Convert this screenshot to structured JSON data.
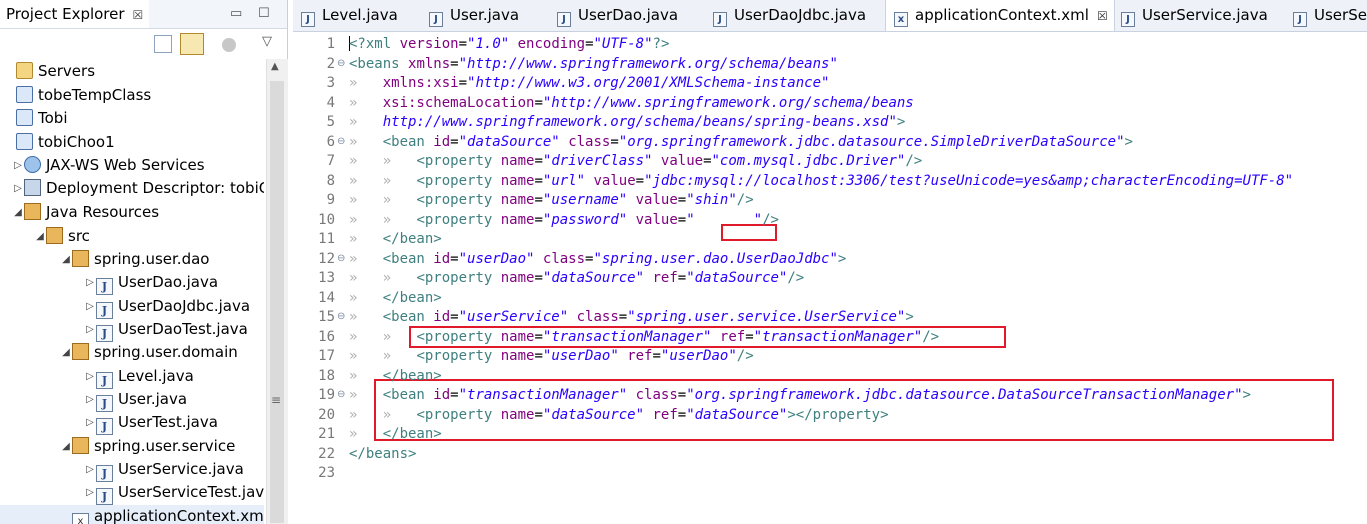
{
  "explorer": {
    "title": "Project Explorer",
    "close_glyph": "☒",
    "minimize_glyph": "▭",
    "maximize_glyph": "☐",
    "menu_glyph": "▽",
    "rows": [
      {
        "label": "Servers",
        "icon": "folder-icon",
        "twisty": "",
        "indent": 0
      },
      {
        "label": "tobeTempClass",
        "icon": "project-icon",
        "twisty": "",
        "indent": 0
      },
      {
        "label": "Tobi",
        "icon": "project-icon",
        "twisty": "",
        "indent": 0
      },
      {
        "label": "tobiChoo1",
        "icon": "project-icon",
        "twisty": "",
        "indent": 0
      },
      {
        "label": "JAX-WS Web Services",
        "icon": "web-services-icon",
        "twisty": "▷",
        "indent": 1
      },
      {
        "label": "Deployment Descriptor: tobiC",
        "icon": "deployment-descriptor-icon",
        "twisty": "▷",
        "indent": 1
      },
      {
        "label": "Java Resources",
        "icon": "java-resources-icon",
        "twisty": "◢",
        "indent": 1
      },
      {
        "label": "src",
        "icon": "source-folder-icon",
        "twisty": "◢",
        "indent": 2
      },
      {
        "label": "spring.user.dao",
        "icon": "package-icon",
        "twisty": "◢",
        "indent": 3
      },
      {
        "label": "UserDao.java",
        "icon": "java-file-icon",
        "twisty": "▷",
        "indent": 4
      },
      {
        "label": "UserDaoJdbc.java",
        "icon": "java-file-icon",
        "twisty": "▷",
        "indent": 4
      },
      {
        "label": "UserDaoTest.java",
        "icon": "java-file-icon",
        "twisty": "▷",
        "indent": 4
      },
      {
        "label": "spring.user.domain",
        "icon": "package-icon",
        "twisty": "◢",
        "indent": 3
      },
      {
        "label": "Level.java",
        "icon": "java-file-icon",
        "twisty": "▷",
        "indent": 4
      },
      {
        "label": "User.java",
        "icon": "java-file-icon",
        "twisty": "▷",
        "indent": 4
      },
      {
        "label": "UserTest.java",
        "icon": "java-file-icon",
        "twisty": "▷",
        "indent": 4
      },
      {
        "label": "spring.user.service",
        "icon": "package-icon",
        "twisty": "◢",
        "indent": 3
      },
      {
        "label": "UserService.java",
        "icon": "java-file-icon",
        "twisty": "▷",
        "indent": 4
      },
      {
        "label": "UserServiceTest.java",
        "icon": "java-file-icon",
        "twisty": "▷",
        "indent": 4
      },
      {
        "label": "applicationContext.xml",
        "icon": "xml-file-icon",
        "twisty": "",
        "indent": 3
      }
    ]
  },
  "editor": {
    "tabs": [
      {
        "label": "Level.java",
        "icon": "java-file-icon",
        "active": false
      },
      {
        "label": "User.java",
        "icon": "java-file-icon",
        "active": false
      },
      {
        "label": "UserDao.java",
        "icon": "java-file-icon",
        "active": false
      },
      {
        "label": "UserDaoJdbc.java",
        "icon": "java-file-icon",
        "active": false
      },
      {
        "label": "applicationContext.xml",
        "icon": "xml-file-icon",
        "active": true
      },
      {
        "label": "UserService.java",
        "icon": "java-file-icon",
        "active": false
      },
      {
        "label": "UserSe",
        "icon": "java-file-icon",
        "active": false
      }
    ],
    "active_tab_close": "☒",
    "lines": [
      {
        "n": "1",
        "fold": "",
        "guides": "",
        "parts": [
          [
            "pi",
            "<?xml "
          ],
          [
            "an",
            "version"
          ],
          [
            "txt",
            "="
          ],
          [
            "av",
            "\"1.0\""
          ],
          [
            "txt",
            " "
          ],
          [
            "an",
            "encoding"
          ],
          [
            "txt",
            "="
          ],
          [
            "av",
            "\"UTF-8\""
          ],
          [
            "pi",
            "?>"
          ]
        ]
      },
      {
        "n": "2",
        "fold": "⊖",
        "guides": "",
        "parts": [
          [
            "tag",
            "<beans "
          ],
          [
            "an",
            "xmlns"
          ],
          [
            "txt",
            "="
          ],
          [
            "av",
            "\"http://www.springframework.org/schema/beans\""
          ]
        ]
      },
      {
        "n": "3",
        "fold": "",
        "guides": "»   ",
        "parts": [
          [
            "an",
            "xmlns:xsi"
          ],
          [
            "txt",
            "="
          ],
          [
            "av",
            "\"http://www.w3.org/2001/XMLSchema-instance\""
          ]
        ]
      },
      {
        "n": "4",
        "fold": "",
        "guides": "»   ",
        "parts": [
          [
            "an",
            "xsi:schemaLocation"
          ],
          [
            "txt",
            "="
          ],
          [
            "av",
            "\"http://www.springframework.org/schema/beans"
          ]
        ]
      },
      {
        "n": "5",
        "fold": "",
        "guides": "»   ",
        "parts": [
          [
            "av",
            "http://www.springframework.org/schema/beans/spring-beans.xsd\""
          ],
          [
            "tag",
            ">"
          ]
        ]
      },
      {
        "n": "6",
        "fold": "⊖",
        "guides": "»   ",
        "parts": [
          [
            "tag",
            "<bean "
          ],
          [
            "an",
            "id"
          ],
          [
            "txt",
            "="
          ],
          [
            "av",
            "\"dataSource\""
          ],
          [
            "txt",
            " "
          ],
          [
            "an",
            "class"
          ],
          [
            "txt",
            "="
          ],
          [
            "av",
            "\"org.springframework.jdbc.datasource.SimpleDriverDataSource\""
          ],
          [
            "tag",
            ">"
          ]
        ]
      },
      {
        "n": "7",
        "fold": "",
        "guides": "»   »   ",
        "parts": [
          [
            "tag",
            "<property "
          ],
          [
            "an",
            "name"
          ],
          [
            "txt",
            "="
          ],
          [
            "av",
            "\"driverClass\""
          ],
          [
            "txt",
            " "
          ],
          [
            "an",
            "value"
          ],
          [
            "txt",
            "="
          ],
          [
            "av",
            "\"com.mysql.jdbc.Driver\""
          ],
          [
            "tag",
            "/>"
          ]
        ]
      },
      {
        "n": "8",
        "fold": "",
        "guides": "»   »   ",
        "parts": [
          [
            "tag",
            "<property "
          ],
          [
            "an",
            "name"
          ],
          [
            "txt",
            "="
          ],
          [
            "av",
            "\"url\""
          ],
          [
            "txt",
            " "
          ],
          [
            "an",
            "value"
          ],
          [
            "txt",
            "="
          ],
          [
            "av",
            "\"jdbc:mysql://localhost:3306/test?useUnicode=yes&amp;characterEncoding=UTF-8\""
          ]
        ]
      },
      {
        "n": "9",
        "fold": "",
        "guides": "»   »   ",
        "parts": [
          [
            "tag",
            "<property "
          ],
          [
            "an",
            "name"
          ],
          [
            "txt",
            "="
          ],
          [
            "av",
            "\"username\""
          ],
          [
            "txt",
            " "
          ],
          [
            "an",
            "value"
          ],
          [
            "txt",
            "="
          ],
          [
            "av",
            "\"shin\""
          ],
          [
            "tag",
            "/>"
          ]
        ]
      },
      {
        "n": "10",
        "fold": "",
        "guides": "»   »   ",
        "parts": [
          [
            "tag",
            "<property "
          ],
          [
            "an",
            "name"
          ],
          [
            "txt",
            "="
          ],
          [
            "av",
            "\"password\""
          ],
          [
            "txt",
            " "
          ],
          [
            "an",
            "value"
          ],
          [
            "txt",
            "="
          ],
          [
            "av",
            "\"       \""
          ],
          [
            "tag",
            "/>"
          ]
        ]
      },
      {
        "n": "11",
        "fold": "",
        "guides": "»   ",
        "parts": [
          [
            "tag",
            "</bean>"
          ]
        ]
      },
      {
        "n": "12",
        "fold": "⊖",
        "guides": "»   ",
        "parts": [
          [
            "tag",
            "<bean "
          ],
          [
            "an",
            "id"
          ],
          [
            "txt",
            "="
          ],
          [
            "av",
            "\"userDao\""
          ],
          [
            "txt",
            " "
          ],
          [
            "an",
            "class"
          ],
          [
            "txt",
            "="
          ],
          [
            "av",
            "\"spring.user.dao.UserDaoJdbc\""
          ],
          [
            "tag",
            ">"
          ]
        ]
      },
      {
        "n": "13",
        "fold": "",
        "guides": "»   »   ",
        "parts": [
          [
            "tag",
            "<property "
          ],
          [
            "an",
            "name"
          ],
          [
            "txt",
            "="
          ],
          [
            "av",
            "\"dataSource\""
          ],
          [
            "txt",
            " "
          ],
          [
            "an",
            "ref"
          ],
          [
            "txt",
            "="
          ],
          [
            "av",
            "\"dataSource\""
          ],
          [
            "tag",
            "/>"
          ]
        ]
      },
      {
        "n": "14",
        "fold": "",
        "guides": "»   ",
        "parts": [
          [
            "tag",
            "</bean>"
          ]
        ]
      },
      {
        "n": "15",
        "fold": "⊖",
        "guides": "»   ",
        "parts": [
          [
            "tag",
            "<bean "
          ],
          [
            "an",
            "id"
          ],
          [
            "txt",
            "="
          ],
          [
            "av",
            "\"userService\""
          ],
          [
            "txt",
            " "
          ],
          [
            "an",
            "class"
          ],
          [
            "txt",
            "="
          ],
          [
            "av",
            "\"spring.user.service.UserService\""
          ],
          [
            "tag",
            ">"
          ]
        ]
      },
      {
        "n": "16",
        "fold": "",
        "guides": "»   »   ",
        "parts": [
          [
            "tag",
            "<property "
          ],
          [
            "an",
            "name"
          ],
          [
            "txt",
            "="
          ],
          [
            "av",
            "\"transactionManager\""
          ],
          [
            "txt",
            " "
          ],
          [
            "an",
            "ref"
          ],
          [
            "txt",
            "="
          ],
          [
            "av",
            "\"transactionManager\""
          ],
          [
            "tag",
            "/>"
          ]
        ]
      },
      {
        "n": "17",
        "fold": "",
        "guides": "»   »   ",
        "parts": [
          [
            "tag",
            "<property "
          ],
          [
            "an",
            "name"
          ],
          [
            "txt",
            "="
          ],
          [
            "av",
            "\"userDao\""
          ],
          [
            "txt",
            " "
          ],
          [
            "an",
            "ref"
          ],
          [
            "txt",
            "="
          ],
          [
            "av",
            "\"userDao\""
          ],
          [
            "tag",
            "/>"
          ]
        ]
      },
      {
        "n": "18",
        "fold": "",
        "guides": "»   ",
        "parts": [
          [
            "tag",
            "</bean>"
          ]
        ]
      },
      {
        "n": "19",
        "fold": "⊖",
        "guides": "»   ",
        "parts": [
          [
            "tag",
            "<bean "
          ],
          [
            "an",
            "id"
          ],
          [
            "txt",
            "="
          ],
          [
            "av",
            "\"transactionManager\""
          ],
          [
            "txt",
            " "
          ],
          [
            "an",
            "class"
          ],
          [
            "txt",
            "="
          ],
          [
            "av",
            "\"org.springframework.jdbc.datasource.DataSourceTransactionManager\""
          ],
          [
            "tag",
            ">"
          ]
        ]
      },
      {
        "n": "20",
        "fold": "",
        "guides": "»   »   ",
        "parts": [
          [
            "tag",
            "<property "
          ],
          [
            "an",
            "name"
          ],
          [
            "txt",
            "="
          ],
          [
            "av",
            "\"dataSource\""
          ],
          [
            "txt",
            " "
          ],
          [
            "an",
            "ref"
          ],
          [
            "txt",
            "="
          ],
          [
            "av",
            "\"dataSource\""
          ],
          [
            "tag",
            "></property>"
          ]
        ]
      },
      {
        "n": "21",
        "fold": "",
        "guides": "»   ",
        "parts": [
          [
            "tag",
            "</bean>"
          ]
        ]
      },
      {
        "n": "22",
        "fold": "",
        "guides": "",
        "parts": [
          [
            "tag",
            "</beans>"
          ]
        ]
      },
      {
        "n": "23",
        "fold": "",
        "guides": "",
        "parts": []
      }
    ]
  },
  "colors": {
    "highlight_box": "#e0192b",
    "xml_tag": "#3f7f7f",
    "xml_attr_name": "#7f007f",
    "xml_attr_value": "#2a00ff"
  }
}
